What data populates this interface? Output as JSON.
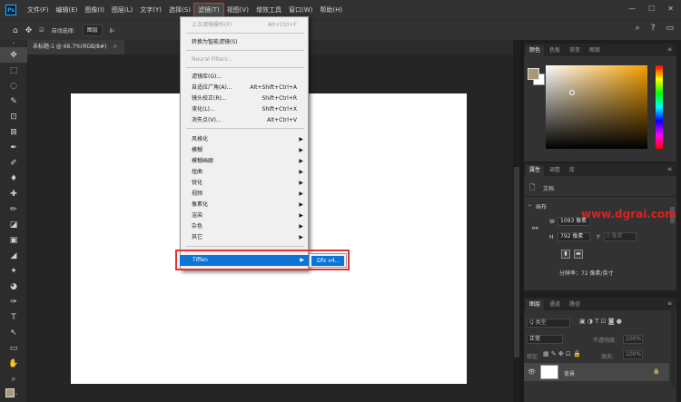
{
  "app": {
    "logo": "Ps"
  },
  "menubar": {
    "items": [
      "文件(F)",
      "编辑(E)",
      "图像(I)",
      "图层(L)",
      "文字(Y)",
      "选择(S)",
      "滤镜(T)",
      "视图(V)",
      "增效工具",
      "窗口(W)",
      "帮助(H)"
    ],
    "active_index": 6
  },
  "window_controls": {
    "minimize": "—",
    "restore": "☐",
    "close": "✕"
  },
  "options_bar": {
    "home": "⌂",
    "move_icon": "✥",
    "auto_select_label": "自动选择:",
    "auto_select_value": "图层",
    "search_icon": "⌕",
    "help_icon": "?",
    "arrange_icon": "▭"
  },
  "document_tab": {
    "title": "未标题-1 @ 66.7%(RGB/8#)",
    "close": "×"
  },
  "toolbar": {
    "tools": [
      "✥",
      "⬚",
      "◌",
      "✎",
      "⊡",
      "⊠",
      "✒",
      "✐",
      "♦",
      "✚",
      "✏",
      "◪",
      "▣",
      "◢",
      "✦",
      "◕",
      "✑",
      "T",
      "↖",
      "▭",
      "✋",
      "⌕",
      "⋯"
    ]
  },
  "filter_menu": {
    "items": [
      {
        "label": "上次滤镜操作(F)",
        "shortcut": "Alt+Ctrl+F",
        "disabled": true
      },
      {
        "label": "转换为智能滤镜(S)",
        "shortcut": "",
        "disabled": false
      },
      {
        "label": "Neural Filters...",
        "shortcut": "",
        "disabled": true
      },
      {
        "label": "滤镜库(G)...",
        "shortcut": "",
        "disabled": false
      },
      {
        "label": "自适应广角(A)...",
        "shortcut": "Alt+Shift+Ctrl+A",
        "disabled": false
      },
      {
        "label": "镜头校正(R)...",
        "shortcut": "Shift+Ctrl+R",
        "disabled": false
      },
      {
        "label": "液化(L)...",
        "shortcut": "Shift+Ctrl+X",
        "disabled": false
      },
      {
        "label": "消失点(V)...",
        "shortcut": "Alt+Ctrl+V",
        "disabled": false
      }
    ],
    "submenus": [
      "风格化",
      "模糊",
      "模糊画廊",
      "扭曲",
      "锐化",
      "视频",
      "像素化",
      "渲染",
      "杂色",
      "其它"
    ],
    "arrow": "▶",
    "plugin": "Tiffen",
    "plugin_item": "Dfx v4..."
  },
  "color_panel": {
    "tabs": [
      "颜色",
      "色板",
      "渐变",
      "图案"
    ],
    "foreground": "#a89878",
    "background": "#ffffff",
    "hue_color": "#f5a000",
    "menu": "≡"
  },
  "properties_panel": {
    "tabs": [
      "属性",
      "调整",
      "库"
    ],
    "doc_label": "文档",
    "canvas_label": "画布",
    "w_label": "W",
    "w_value": "1093 像素",
    "h_label": "H",
    "h_value": "792 像素",
    "x_label": "X",
    "y_label": "Y",
    "x_placeholder": "0 像素",
    "y_placeholder": "0 像素",
    "resolution": "分辨率：72 像素/英寸",
    "menu": "≡"
  },
  "layers_panel": {
    "tabs": [
      "图层",
      "通道",
      "路径"
    ],
    "filter_label": "Q 类型",
    "blend_mode": "正常",
    "opacity_label": "不透明度:",
    "opacity_value": "100%",
    "lock_label": "锁定:",
    "fill_label": "填充:",
    "fill_value": "100%",
    "layer_name": "背景",
    "lock_icon": "🔒",
    "eye_icon": "👁",
    "menu": "≡"
  },
  "watermark": "www.dgrai.com"
}
